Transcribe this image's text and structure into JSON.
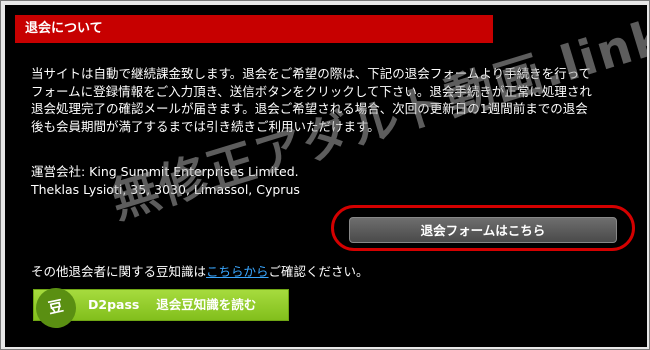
{
  "header": {
    "title": "退会について"
  },
  "intro": {
    "lines": [
      "当サイトは自動で継続課金致します。退会をご希望の際は、下記の退会フォームより手続きを行って",
      "フォームに登録情報をご入力頂き、送信ボタンをクリックして下さい。退会手続きが正常に処理され",
      "退会処理完了の確認メールが届きます。退会ご希望される場合、次回の更新日の1週間前までの退会",
      "後も会員期間が満了するまでは引き続きご利用いただけます。"
    ]
  },
  "company": {
    "line1": "運営会社: King Summit Enterprises Limited.",
    "line2": "Theklas Lysioti, 35, 3030, Limassol, Cyprus"
  },
  "cta": {
    "label": "退会フォームはこちら",
    "ring_color": "#d40000"
  },
  "trivia": {
    "prefix": "その他退会者に関する豆知識は",
    "link": "こちらから",
    "suffix": "ご確認ください。"
  },
  "banner": {
    "badge": "豆",
    "label": "D2pass　 退会豆知識を読む",
    "color": "#8fca28"
  },
  "watermark": {
    "text": "無修正アダルト動画.link"
  },
  "colors": {
    "header_bg": "#c70000",
    "panel_bg": "#000000",
    "link": "#3aa7ff"
  }
}
